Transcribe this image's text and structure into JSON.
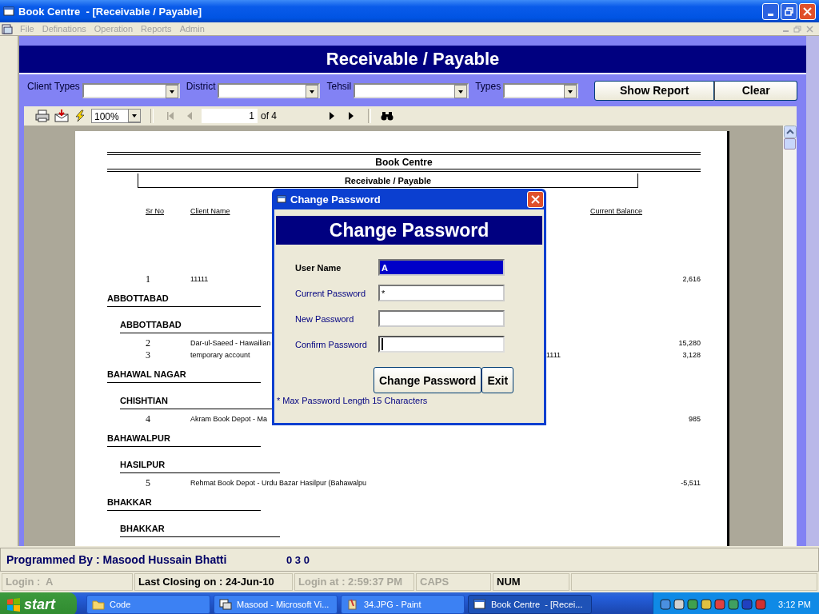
{
  "window": {
    "title": "Book Centre  - [Receivable / Payable]"
  },
  "menu": [
    {
      "label": "File",
      "disabled": true
    },
    {
      "label": "Definations",
      "disabled": true
    },
    {
      "label": "Operation",
      "disabled": true
    },
    {
      "label": "Reports",
      "disabled": true
    },
    {
      "label": "Admin",
      "disabled": true
    }
  ],
  "form": {
    "title": "Receivable / Payable",
    "filters": [
      {
        "label": "Client Types"
      },
      {
        "label": "District"
      },
      {
        "label": "Tehsil"
      },
      {
        "label": "Types"
      }
    ],
    "buttons": [
      "Show Report",
      "Clear"
    ]
  },
  "viewer": {
    "zoom": "100%",
    "page": "1",
    "page_count": "of 4",
    "nav": [
      {
        "kind": "first",
        "disabled": true
      },
      {
        "kind": "prev",
        "disabled": true
      },
      {
        "kind": "next",
        "disabled": false
      },
      {
        "kind": "last",
        "disabled": false
      }
    ]
  },
  "report": {
    "company": "Book Centre",
    "title": "Receivable / Payable",
    "columns": [
      {
        "label": "Sr No"
      },
      {
        "label": "Client Name"
      },
      {
        "label": "Current Balance"
      }
    ],
    "entries": [
      {
        "kind": "row",
        "sr": "1",
        "client": "11111",
        "balance": "2,616"
      },
      {
        "kind": "district",
        "label": "ABBOTTABAD"
      },
      {
        "kind": "tehsil",
        "label": "ABBOTTABAD"
      },
      {
        "kind": "row",
        "sr": "2",
        "client": "Dar-ul-Saeed - Hawailian",
        "balance": "15,280"
      },
      {
        "kind": "row",
        "sr": "3",
        "client": "temporary account",
        "column_3": "1111",
        "balance": "3,128"
      },
      {
        "kind": "district",
        "label": "BAHAWAL NAGAR"
      },
      {
        "kind": "tehsil",
        "label": "CHISHTIAN"
      },
      {
        "kind": "row",
        "sr": "4",
        "client": "Akram Book Depot - Ma",
        "balance": "985"
      },
      {
        "kind": "district",
        "label": "BAHAWALPUR"
      },
      {
        "kind": "tehsil",
        "label": "HASILPUR"
      },
      {
        "kind": "row",
        "sr": "5",
        "client": "Rehmat Book Depot - Urdu Bazar Hasilpur (Bahawalpu",
        "balance": "-5,511"
      },
      {
        "kind": "district",
        "label": "BHAKKAR"
      },
      {
        "kind": "tehsil",
        "label": "BHAKKAR"
      }
    ]
  },
  "dialog": {
    "title": "Change Password",
    "heading": "Change Password",
    "fields": [
      {
        "kind": "user",
        "label": "User Name",
        "value": "A",
        "selected": true,
        "focused": false
      },
      {
        "kind": "password",
        "label": "Current Password",
        "value": "*",
        "selected": false,
        "focused": false
      },
      {
        "kind": "password",
        "label": "New Password",
        "selected": false,
        "focused": false
      },
      {
        "kind": "password",
        "label": "Confirm Password",
        "selected": false,
        "focused": true
      }
    ],
    "buttons": [
      "Change Password",
      "Exit"
    ],
    "note": "* Max Password Length 15 Characters"
  },
  "footer": {
    "credit": "Programmed By : Masood Hussain Bhatti",
    "code": "0 3 0"
  },
  "status_bar": [
    {
      "text": "Login :  A",
      "disabled": true
    },
    {
      "text": "Last Closing on : 24-Jun-10",
      "disabled": false
    },
    {
      "text": "Login at : 2:59:37 PM",
      "disabled": true
    },
    {
      "text": "CAPS",
      "disabled": true
    },
    {
      "text": "NUM",
      "disabled": false
    }
  ],
  "taskbar": {
    "start": "start",
    "tasks": [
      {
        "kind": "folder",
        "label": "Code",
        "selected": false
      },
      {
        "kind": "vb",
        "label": "Masood - Microsoft Vi...",
        "selected": false
      },
      {
        "kind": "paint",
        "label": "34.JPG - Paint",
        "selected": false
      },
      {
        "kind": "app",
        "label": "Book Centre  - [Recei...",
        "selected": true
      }
    ],
    "clock": "3:12 PM"
  }
}
